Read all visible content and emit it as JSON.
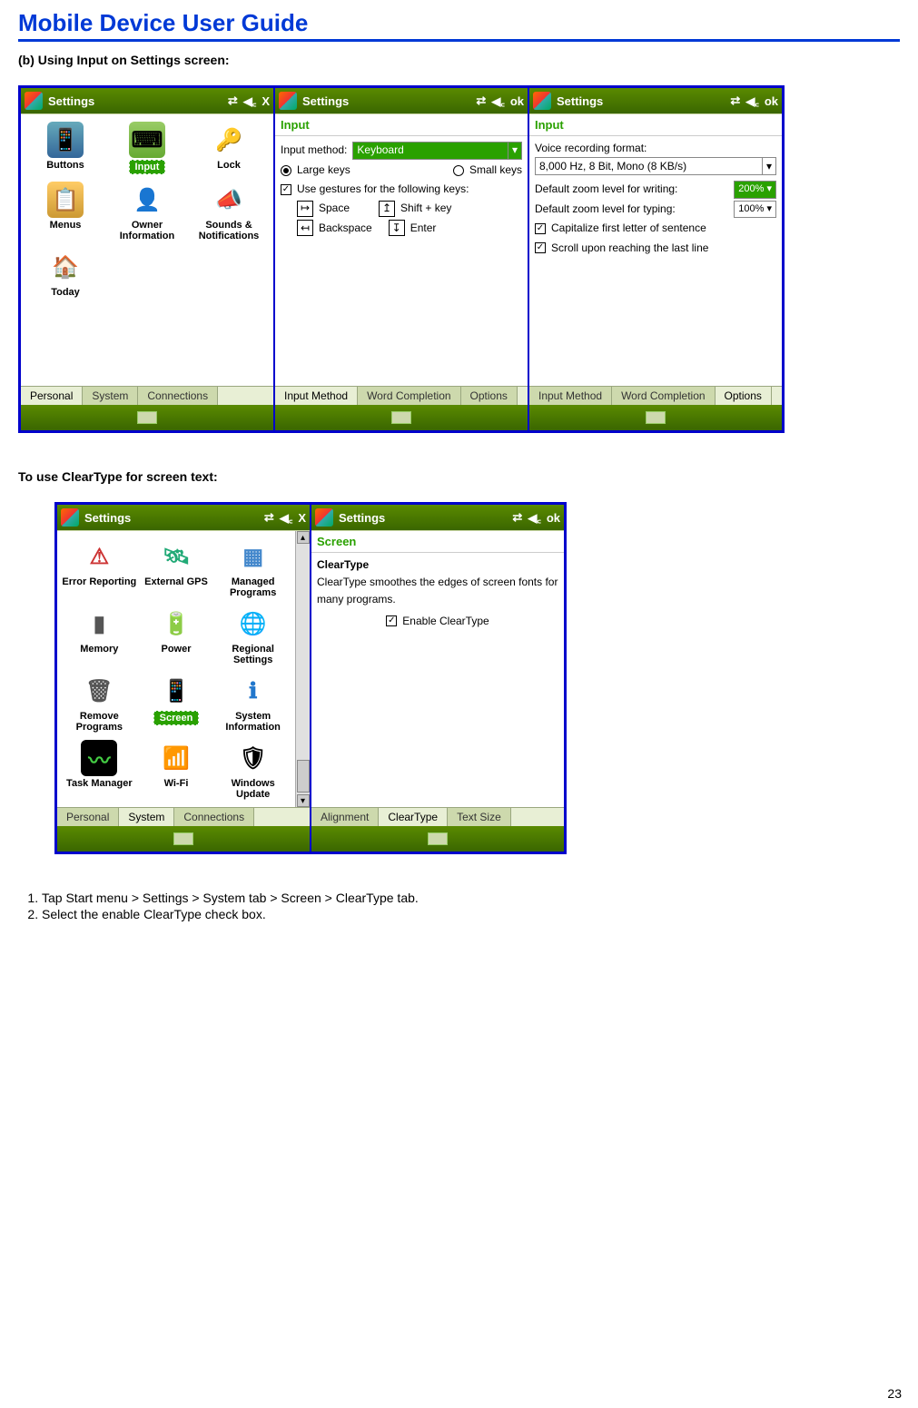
{
  "page": {
    "title": "Mobile Device User Guide",
    "heading_b": "(b)   Using Input on Settings screen:",
    "heading_ct": "To use ClearType for screen text:",
    "steps": [
      "Tap Start menu > Settings > System tab > Screen > ClearType tab.",
      "Select the enable ClearType check box."
    ],
    "page_number": "23"
  },
  "titlebar": {
    "settings": "Settings",
    "ok": "ok",
    "close": "X"
  },
  "screen1": {
    "icons": [
      {
        "label": "Buttons"
      },
      {
        "label": "Input",
        "hl": true
      },
      {
        "label": "Lock"
      },
      {
        "label": "Menus"
      },
      {
        "label": "Owner Information"
      },
      {
        "label": "Sounds & Notifications"
      },
      {
        "label": "Today"
      }
    ],
    "tabs": {
      "personal": "Personal",
      "system": "System",
      "connections": "Connections"
    }
  },
  "screen2": {
    "head": "Input",
    "input_method_label": "Input method:",
    "input_method_value": "Keyboard",
    "large": "Large keys",
    "small": "Small keys",
    "gestures": "Use gestures for the following keys:",
    "space": "Space",
    "shift": "Shift + key",
    "back": "Backspace",
    "enter": "Enter",
    "tabs": {
      "im": "Input Method",
      "wc": "Word Completion",
      "opt": "Options"
    }
  },
  "screen3": {
    "head": "Input",
    "voice": "Voice recording format:",
    "voice_val": "8,000 Hz, 8 Bit, Mono (8 KB/s)",
    "zwrite": "Default zoom level for writing:",
    "zwrite_val": "200%",
    "ztype": "Default zoom level for typing:",
    "ztype_val": "100%",
    "cap": "Capitalize first letter of sentence",
    "scroll": "Scroll upon reaching the last line",
    "tabs": {
      "im": "Input Method",
      "wc": "Word Completion",
      "opt": "Options"
    }
  },
  "screen4": {
    "icons": [
      {
        "label": "Error Reporting"
      },
      {
        "label": "External GPS"
      },
      {
        "label": "Managed Programs"
      },
      {
        "label": "Memory"
      },
      {
        "label": "Power"
      },
      {
        "label": "Regional Settings"
      },
      {
        "label": "Remove Programs"
      },
      {
        "label": "Screen",
        "hl": true
      },
      {
        "label": "System Information"
      },
      {
        "label": "Task Manager"
      },
      {
        "label": "Wi-Fi"
      },
      {
        "label": "Windows Update"
      }
    ],
    "tabs": {
      "personal": "Personal",
      "system": "System",
      "connections": "Connections"
    }
  },
  "screen5": {
    "head": "Screen",
    "ct": "ClearType",
    "desc": "ClearType smoothes the edges of screen fonts for many programs.",
    "enable": "Enable ClearType",
    "tabs": {
      "al": "Alignment",
      "ct": "ClearType",
      "ts": "Text Size"
    }
  },
  "icon_colors": {
    "blue": "#3a7bd5",
    "orange": "#e88b2e",
    "yellow": "#f4c430",
    "green": "#6a9a2d",
    "red": "#d14",
    "teal": "#2a9",
    "gray": "#888",
    "purple": "#7a6"
  }
}
